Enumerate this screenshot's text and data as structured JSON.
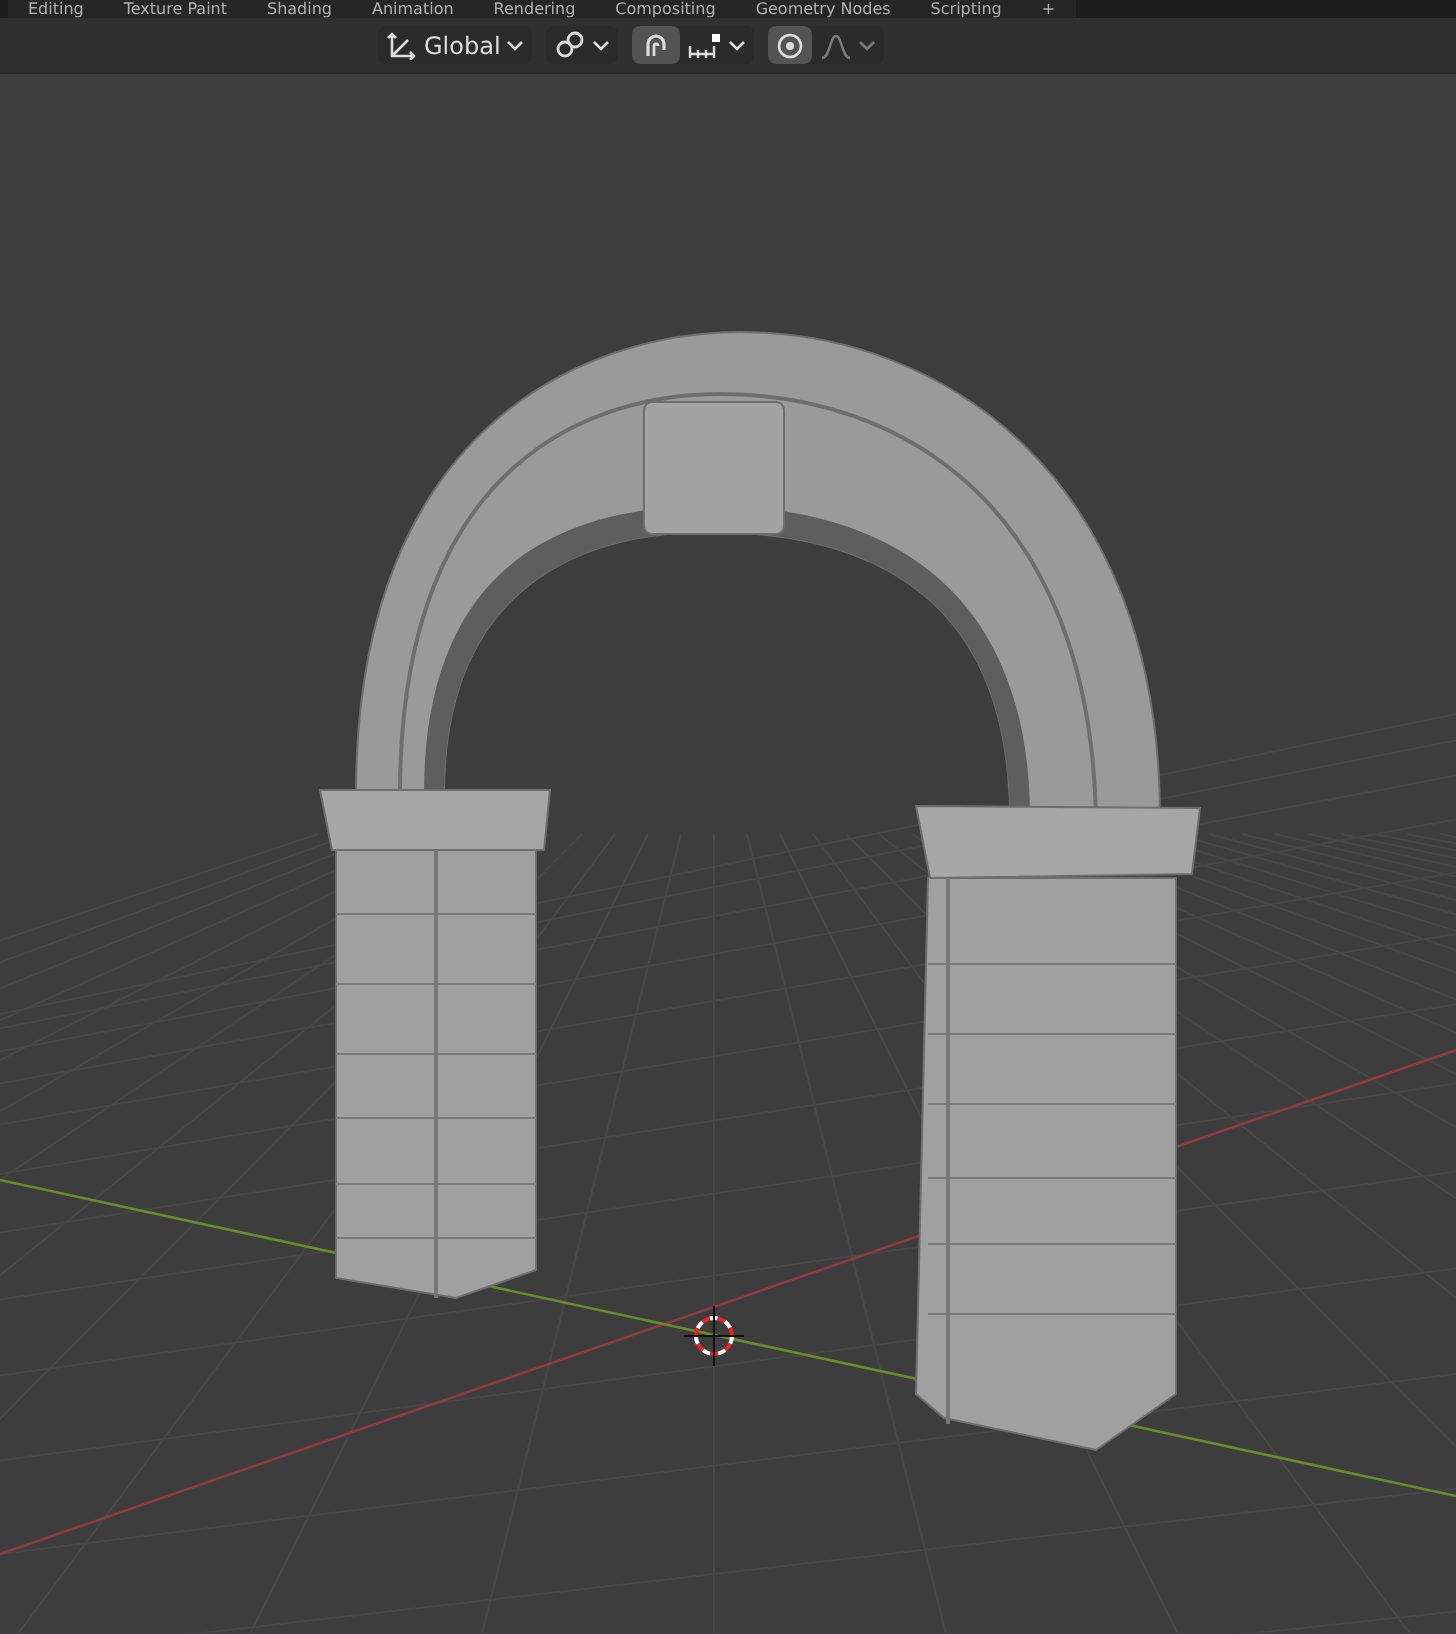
{
  "workspace_tabs": [
    {
      "label": "Editing"
    },
    {
      "label": "Texture Paint"
    },
    {
      "label": "Shading"
    },
    {
      "label": "Animation"
    },
    {
      "label": "Rendering"
    },
    {
      "label": "Compositing"
    },
    {
      "label": "Geometry Nodes"
    },
    {
      "label": "Scripting"
    },
    {
      "label": "+"
    }
  ],
  "header": {
    "orientation": {
      "label": "Global"
    },
    "snap": {
      "on": true
    },
    "proportional_editing": {
      "on": true
    },
    "falloff": {
      "disabled": true
    }
  }
}
